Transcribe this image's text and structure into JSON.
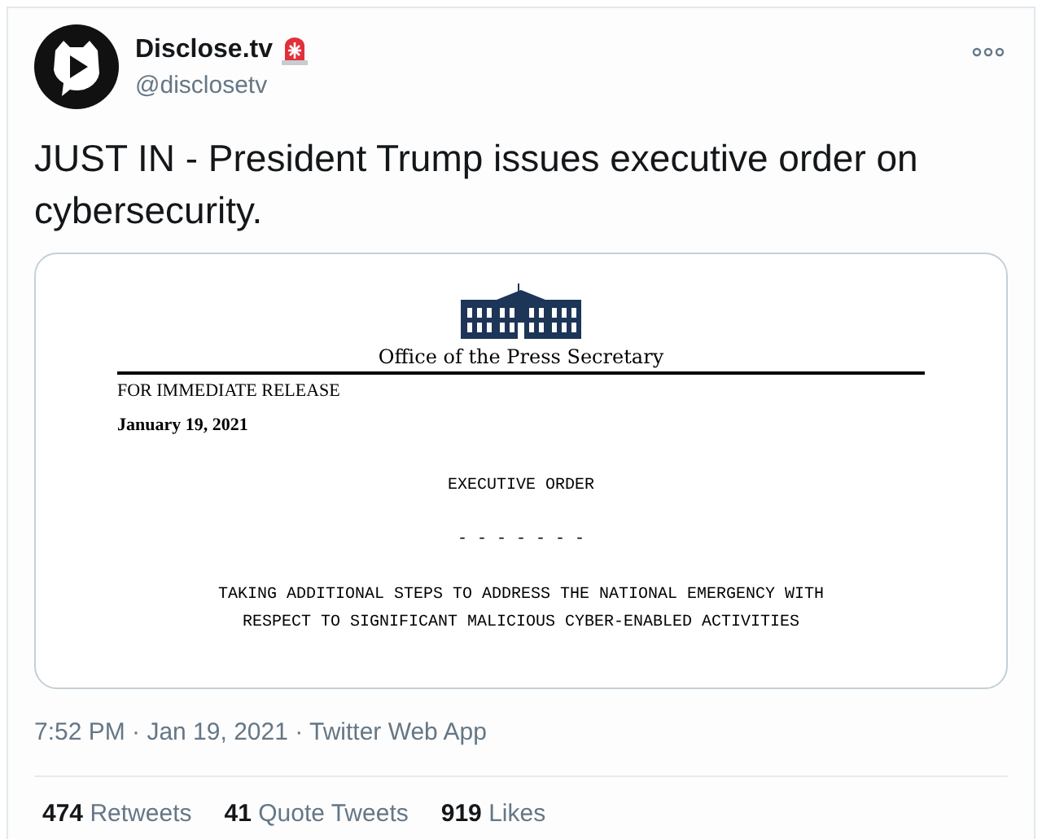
{
  "author": {
    "name": "Disclose.tv",
    "handle": "@disclosetv"
  },
  "tweet_text": "JUST IN - President Trump issues executive order on cybersecurity.",
  "document": {
    "office": "Office of the Press Secretary",
    "release": "FOR IMMEDIATE RELEASE",
    "date": "January 19, 2021",
    "heading": "EXECUTIVE ORDER",
    "separator": "- - - - - - -",
    "title_lines": [
      "TAKING ADDITIONAL STEPS TO ADDRESS THE NATIONAL EMERGENCY WITH",
      "RESPECT TO SIGNIFICANT MALICIOUS CYBER-ENABLED ACTIVITIES"
    ]
  },
  "meta": "7:52 PM · Jan 19, 2021 · Twitter Web App",
  "stats": [
    {
      "count": "474",
      "label": "Retweets"
    },
    {
      "count": "41",
      "label": "Quote Tweets"
    },
    {
      "count": "919",
      "label": "Likes"
    }
  ]
}
